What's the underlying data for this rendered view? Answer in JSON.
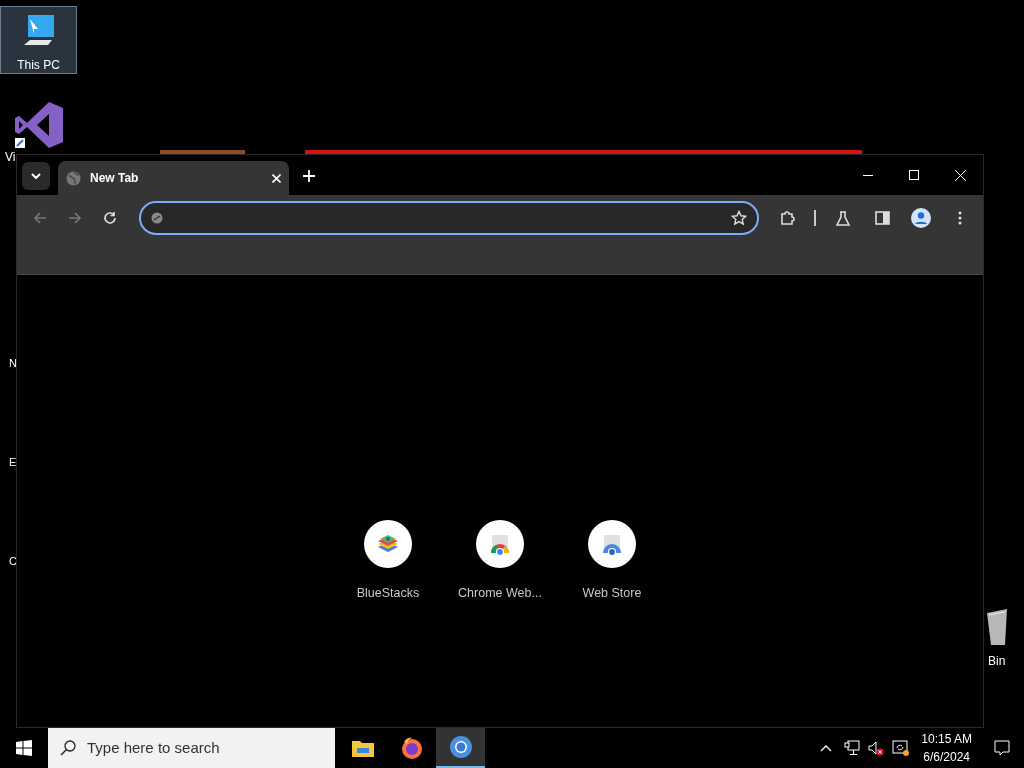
{
  "desktop_icons": [
    {
      "kind": "computer",
      "label": "This PC",
      "selected": true
    },
    {
      "kind": "vs",
      "label": "Vi",
      "selected": false
    },
    {
      "kind": "hidden",
      "label": "N",
      "selected": false
    },
    {
      "kind": "hidden",
      "label": "E",
      "selected": false
    },
    {
      "kind": "hidden",
      "label": "C",
      "selected": false
    },
    {
      "kind": "recycle",
      "label": "Bin",
      "selected": false
    }
  ],
  "browser": {
    "tabs": [
      {
        "label": "New Tab",
        "selected": true
      }
    ],
    "shortcuts": [
      {
        "kind": "bluestacks",
        "label": "BlueStacks"
      },
      {
        "kind": "chrome",
        "label": "Chrome Web..."
      },
      {
        "kind": "webstore",
        "label": "Web Store"
      }
    ]
  },
  "taskbar": {
    "search": {
      "placeholder": "Type here to search"
    },
    "apps": [
      {
        "kind": "folder",
        "selected": false
      },
      {
        "kind": "firefox",
        "selected": false
      },
      {
        "kind": "chrome",
        "selected": true
      }
    ],
    "time": "10:15 AM",
    "date": "6/6/2024"
  }
}
